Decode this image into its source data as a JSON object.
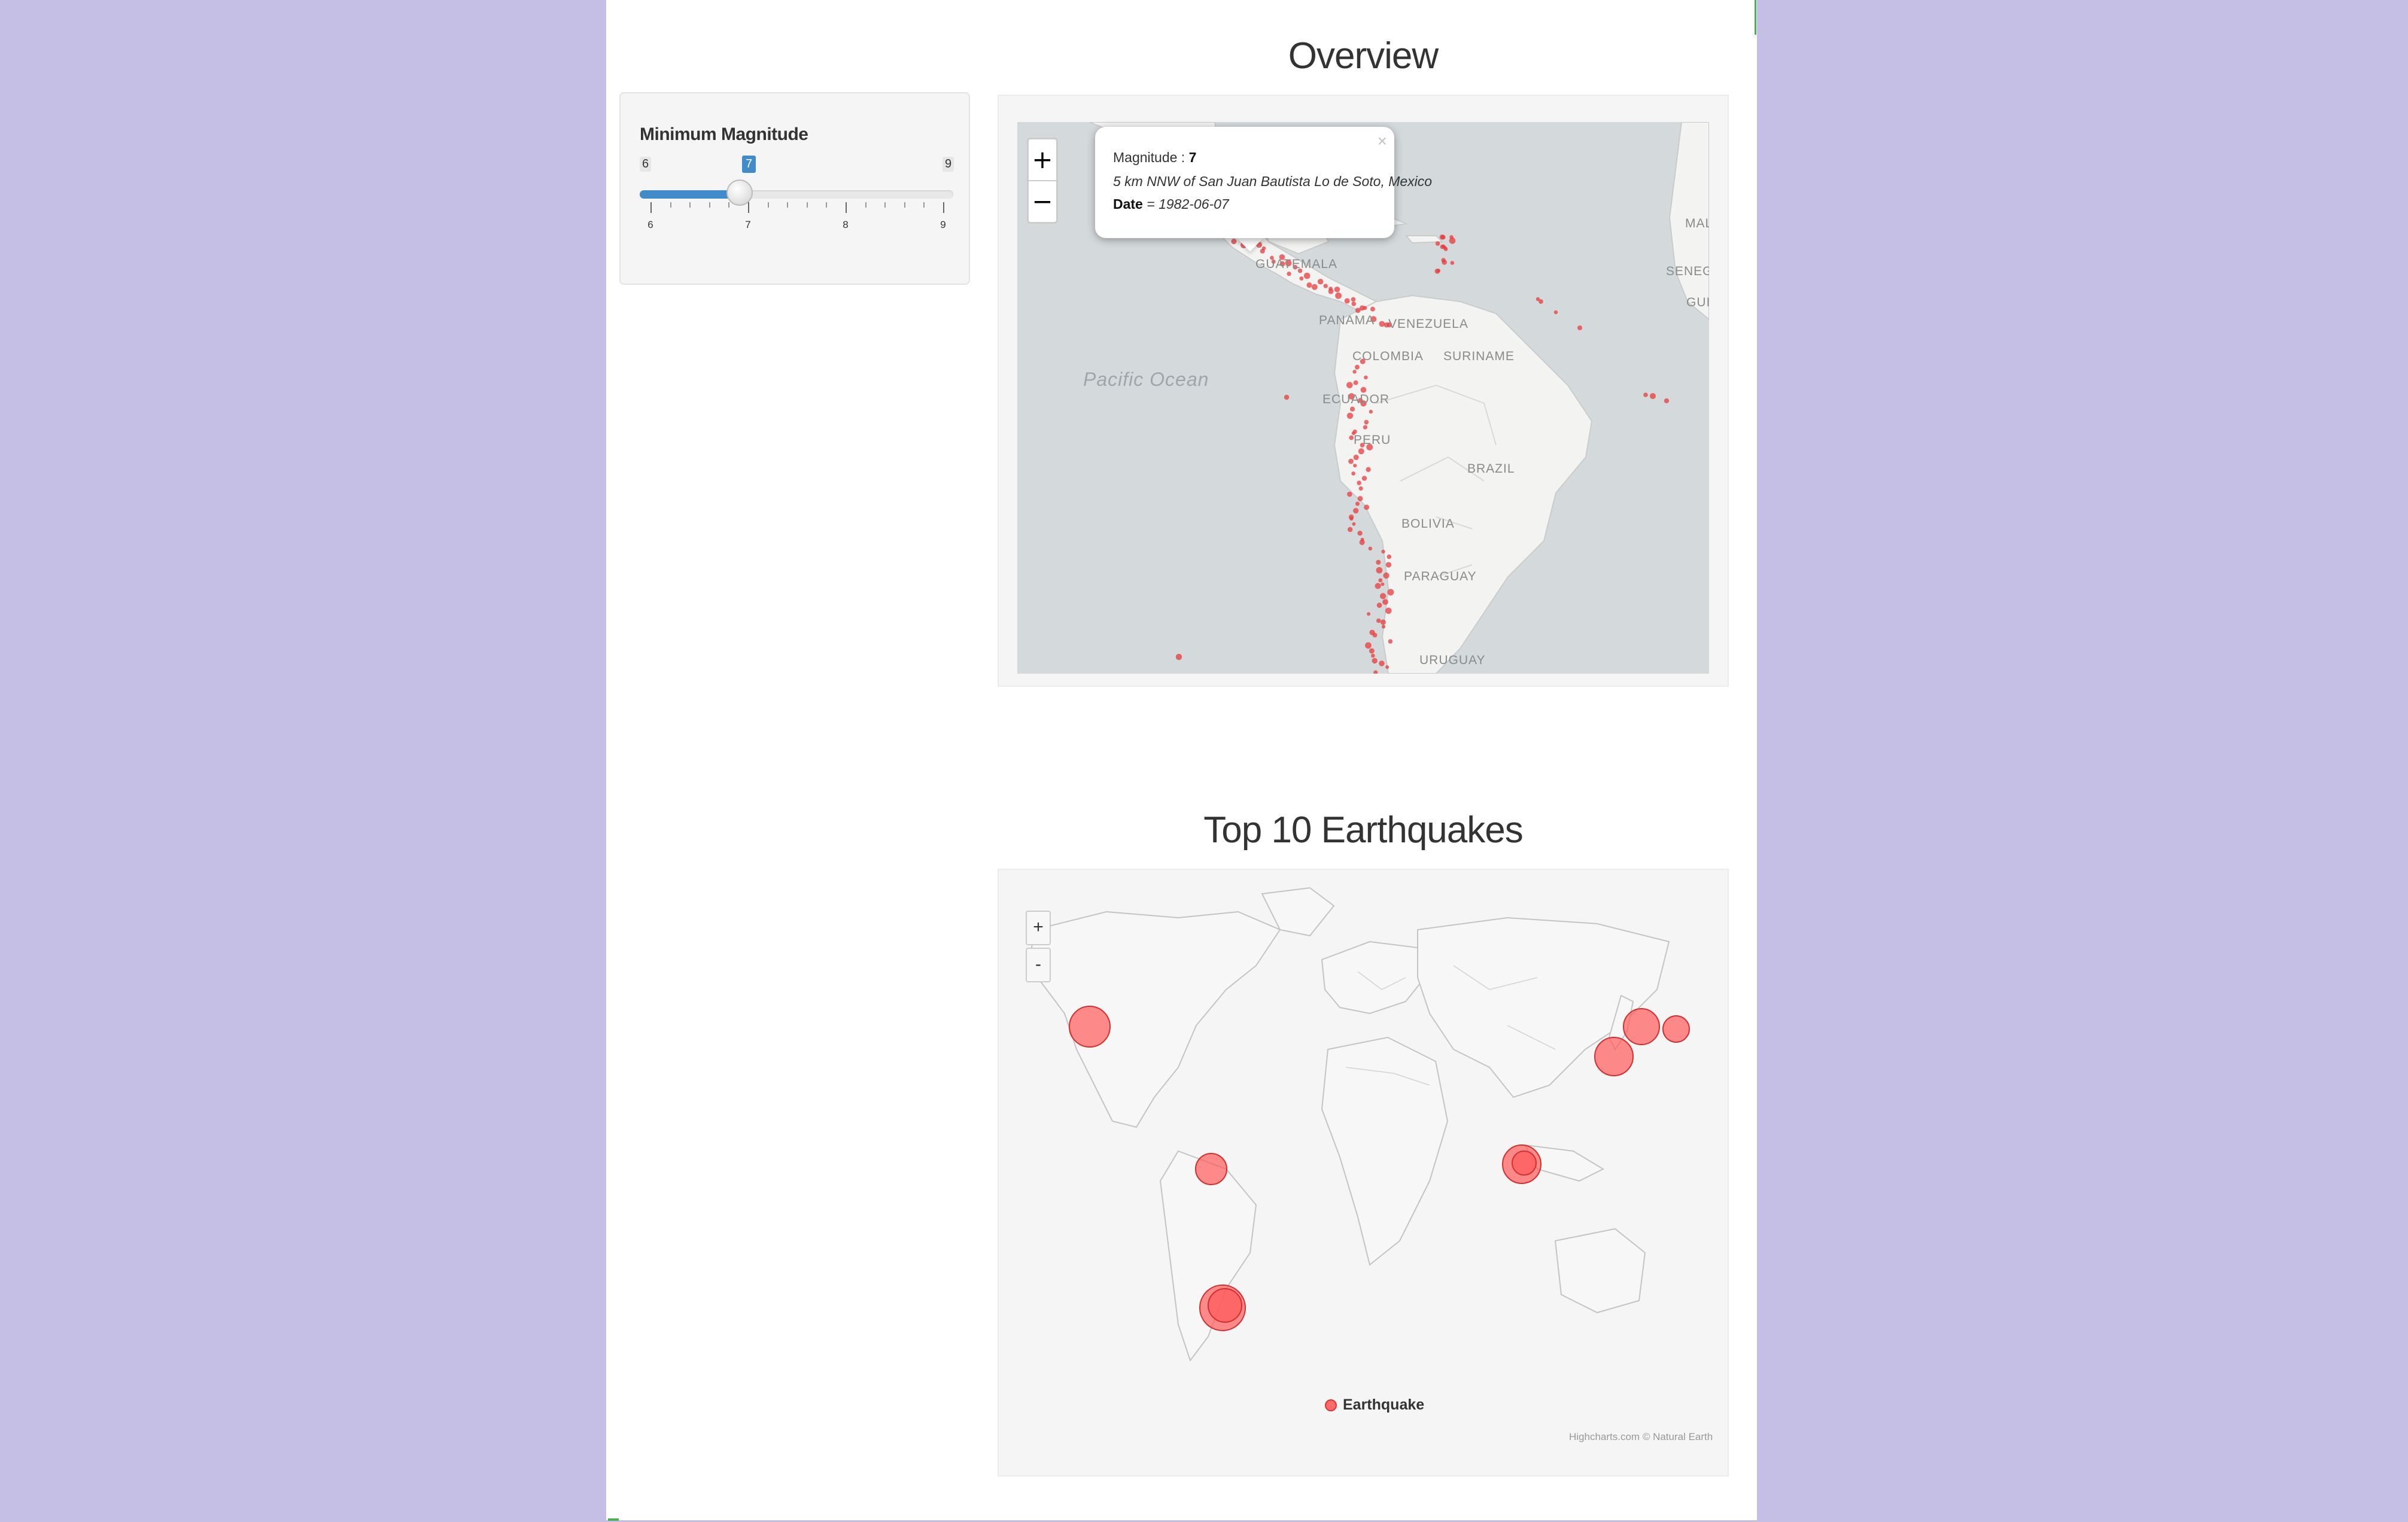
{
  "sidebar": {
    "slider": {
      "label": "Minimum Magnitude",
      "min": 6,
      "max": 9,
      "value": 7,
      "min_label": "6",
      "max_label": "9",
      "value_label": "7",
      "ticks": [
        "6",
        "7",
        "8",
        "9"
      ]
    }
  },
  "overview": {
    "title": "Overview",
    "zoom_in": "+",
    "zoom_out": "−",
    "popup": {
      "close": "×",
      "magnitude_label": "Magnitude : ",
      "magnitude_value": "7",
      "place": "5 km NNW of San Juan Bautista Lo de Soto, Mexico",
      "date_label": "Date",
      "date_value": " = 1982-06-07"
    },
    "ocean_label": "Pacific Ocean",
    "country_labels": [
      "GUATEMALA",
      "PANAMA",
      "VENEZUELA",
      "COLOMBIA",
      "SURINAME",
      "ECUADOR",
      "PERU",
      "BRAZIL",
      "BOLIVIA",
      "PARAGUAY",
      "URUGUAY",
      "MAL",
      "SENEGA",
      "GUI"
    ],
    "marker_color": "#e83b3b"
  },
  "top10": {
    "title": "Top 10 Earthquakes",
    "zoom_in": "+",
    "zoom_out": "-",
    "legend": "Earthquake",
    "credits": "Highcharts.com © Natural Earth",
    "bubble_color": "#ff5a5a"
  },
  "colors": {
    "background": "#c5bfe6",
    "accent": "#428bca"
  }
}
